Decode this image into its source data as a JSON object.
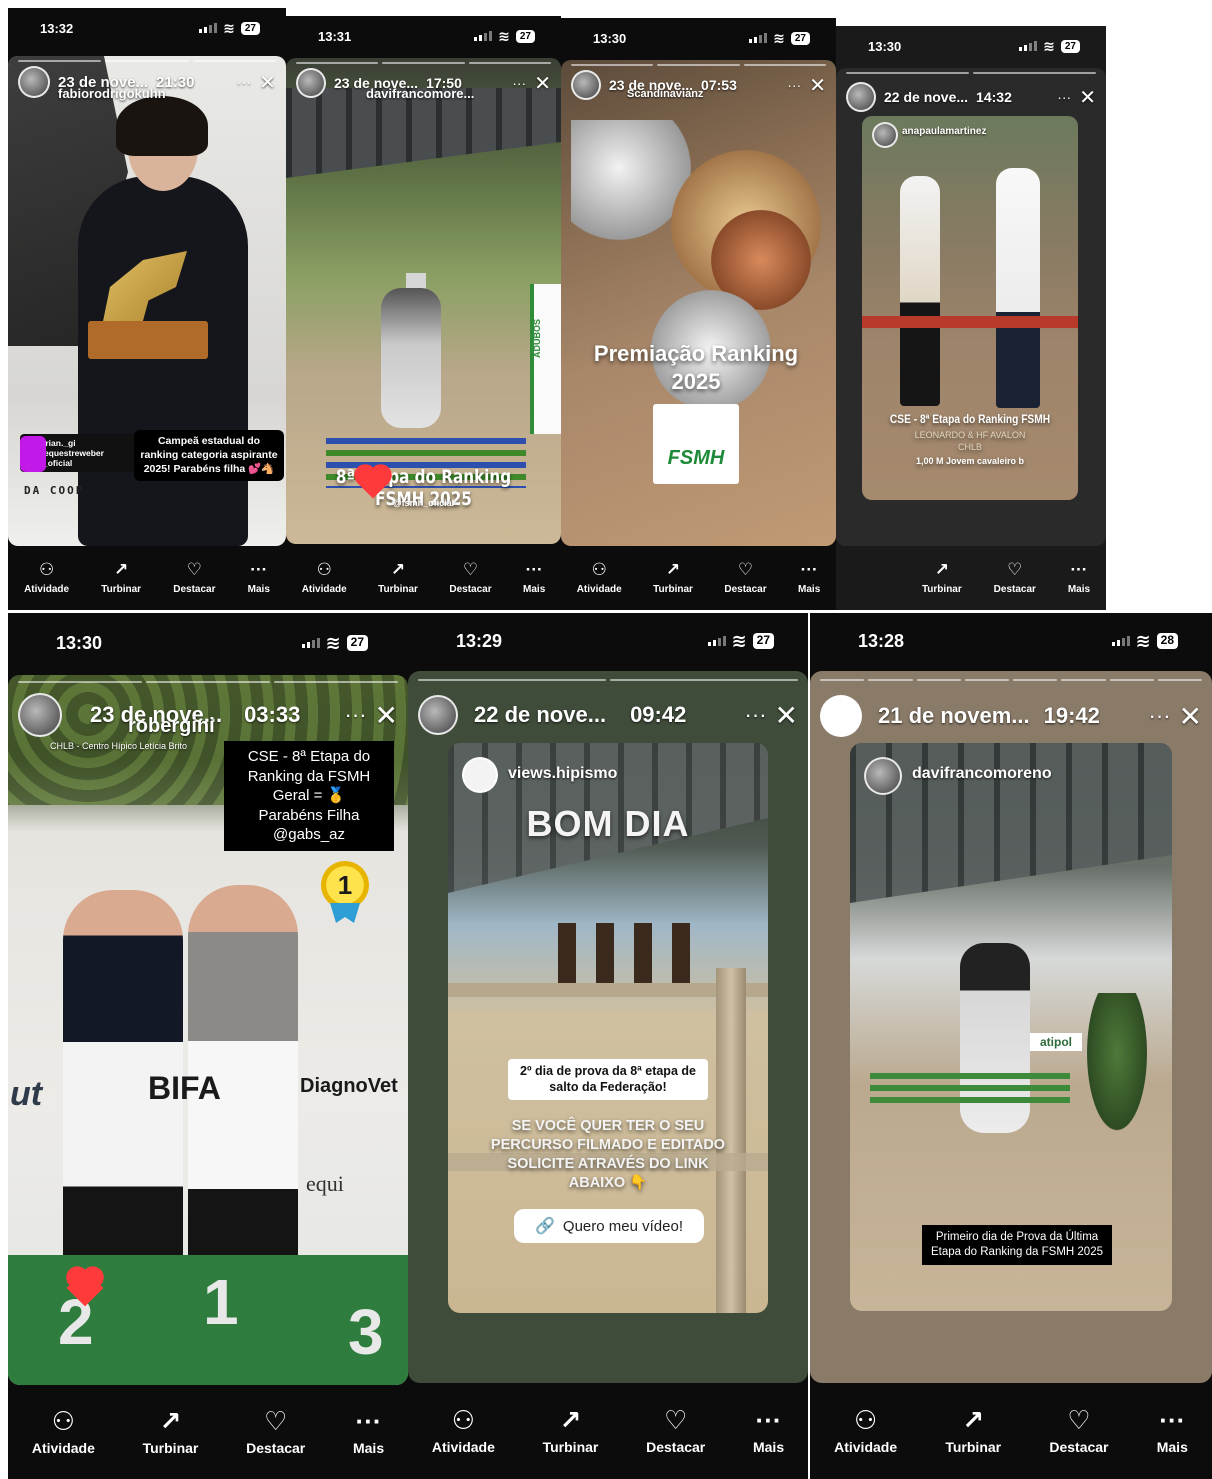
{
  "bar_labels": {
    "activity": "Atividade",
    "boost": "Turbinar",
    "highlight": "Destacar",
    "more": "Mais"
  },
  "ui": {
    "dots": "···",
    "close": "✕"
  },
  "shots": [
    {
      "status_time": "13:32",
      "battery": "27",
      "date": "23 de nove...",
      "time": "21:30",
      "user": "fabiorodrigokuhn",
      "caption": "Campeã estadual do ranking categoria aspirante 2025! Parabéns filha 💕🐴",
      "mentions": "...estrian._gi\n...treequestreweber\n...ah_oficial",
      "sponsor": "DA COOP"
    },
    {
      "status_time": "13:31",
      "battery": "27",
      "date": "23 de nove...",
      "time": "17:50",
      "user": "davifrancomore...",
      "title": "8ª Etapa do Ranking FSMH 2025",
      "handle": "@fsmh_oficial",
      "sponsor": "ADUBOS"
    },
    {
      "status_time": "13:30",
      "battery": "27",
      "date": "23 de nove...",
      "time": "07:53",
      "user": "Scandinavianz",
      "title": "Premiação Ranking 2025",
      "logo": "FSMH"
    },
    {
      "status_time": "13:30",
      "battery": "27",
      "date": "22 de nove...",
      "time": "14:32",
      "repost_user": "anapaulamartinez",
      "caption_title": "CSE - 8ª Etapa do Ranking FSMH",
      "caption_sub": "LEONARDO & HF AVALON",
      "caption_venue": "CHLB",
      "caption_class": "1,00 M Jovem cavaleiro b"
    },
    {
      "status_time": "13:30",
      "battery": "27",
      "date": "23 de nove...",
      "time": "03:33",
      "user": "robergini",
      "location": "CHLB - Centro Hípico Letícia Brito",
      "caption": "CSE - 8ª Etapa do Ranking da FSMH\nGeral = 🥇\nParabéns Filha\n@gabs_az",
      "medal": "1",
      "podium": [
        "2",
        "1",
        "3"
      ],
      "sponsors": [
        "ut",
        "BIFA",
        "DiagnoVet",
        "equi"
      ]
    },
    {
      "status_time": "13:29",
      "battery": "27",
      "date": "22 de nove...",
      "time": "09:42",
      "repost_user": "views.hipismo",
      "headline": "BOM DIA",
      "line1": "2º dia de prova da 8ª etapa de salto da Federação!",
      "line2": "SE VOCÊ QUER TER O SEU PERCURSO FILMADO E EDITADO SOLICITE ATRAVÉS DO LINK ABAIXO 👇",
      "link": "Quero meu vídeo!"
    },
    {
      "status_time": "13:28",
      "battery": "28",
      "date": "21 de novem...",
      "time": "19:42",
      "repost_user": "davifrancomoreno",
      "caption": "Primeiro dia de Prova da Última Etapa do Ranking da FSMH 2025",
      "banner": "atipol"
    }
  ]
}
